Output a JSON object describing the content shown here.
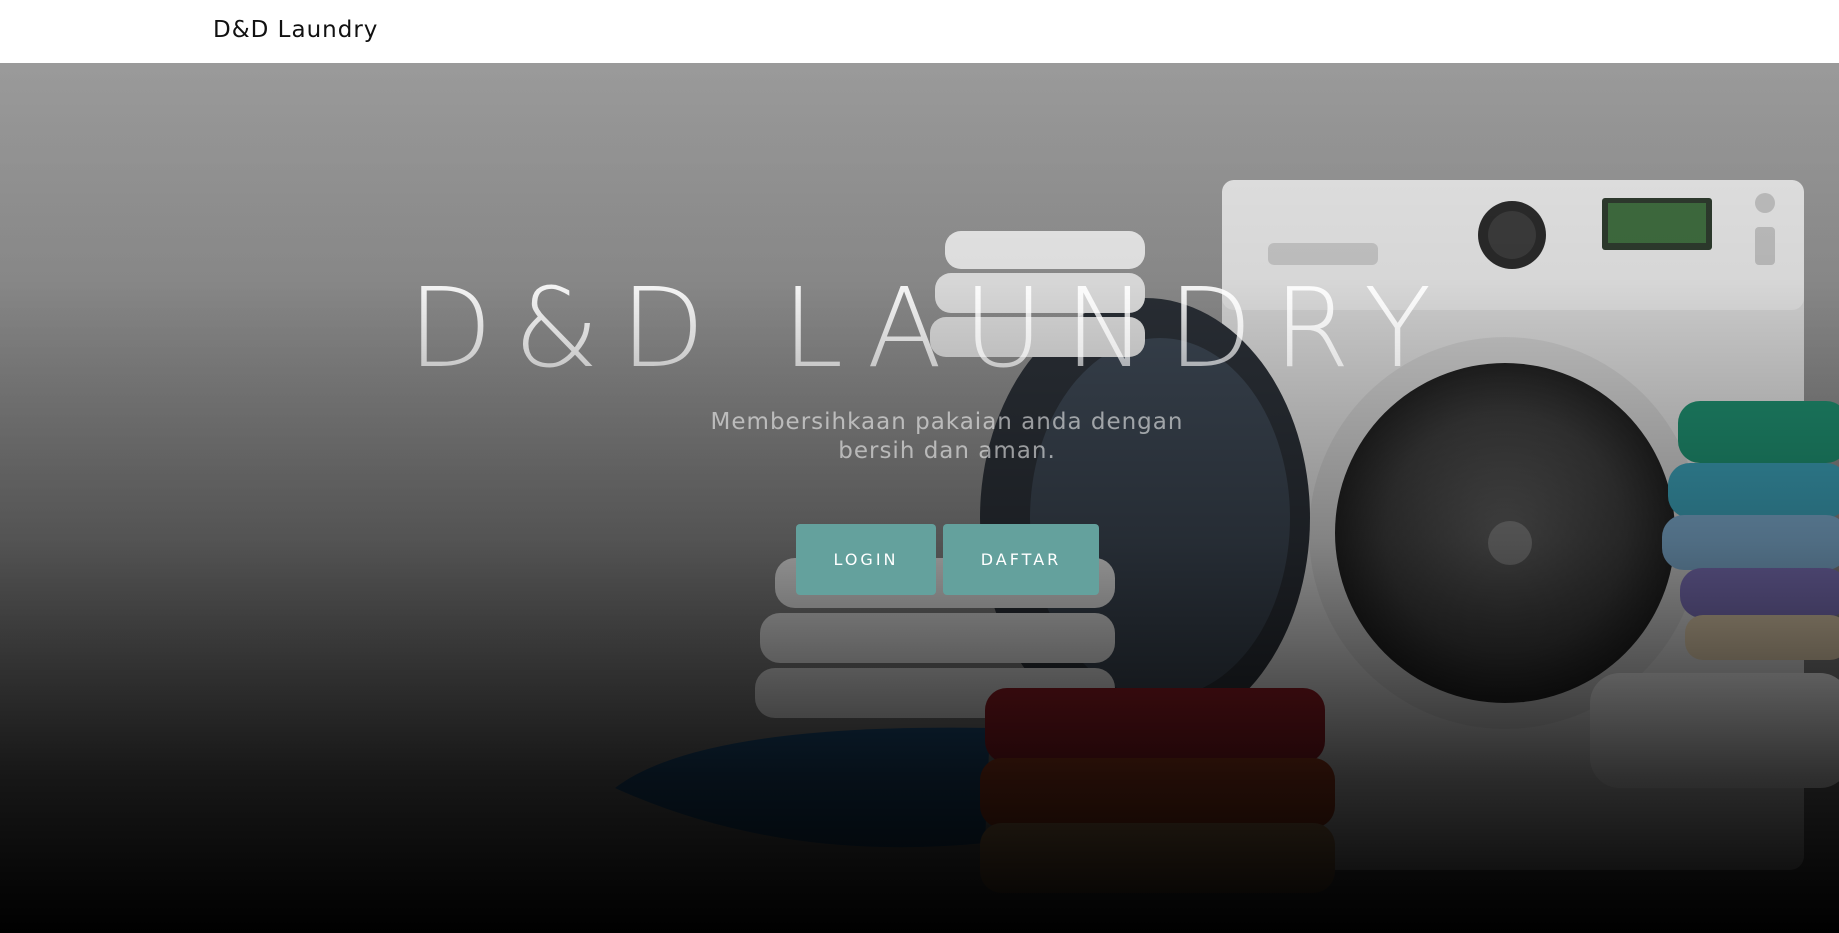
{
  "navbar": {
    "brand": "D&D Laundry"
  },
  "hero": {
    "title": "D&D LAUNDRY",
    "subtitle": "Membersihkaan pakaian anda dengan bersih dan aman.",
    "buttons": {
      "login_label": "LOGIN",
      "daftar_label": "DAFTAR"
    },
    "background_image": "laundry-washing-machine-photo"
  },
  "colors": {
    "navbar_bg": "#ffffff",
    "brand_text": "#111111",
    "button_bg": "#64a19d",
    "button_text": "#ffffff"
  }
}
